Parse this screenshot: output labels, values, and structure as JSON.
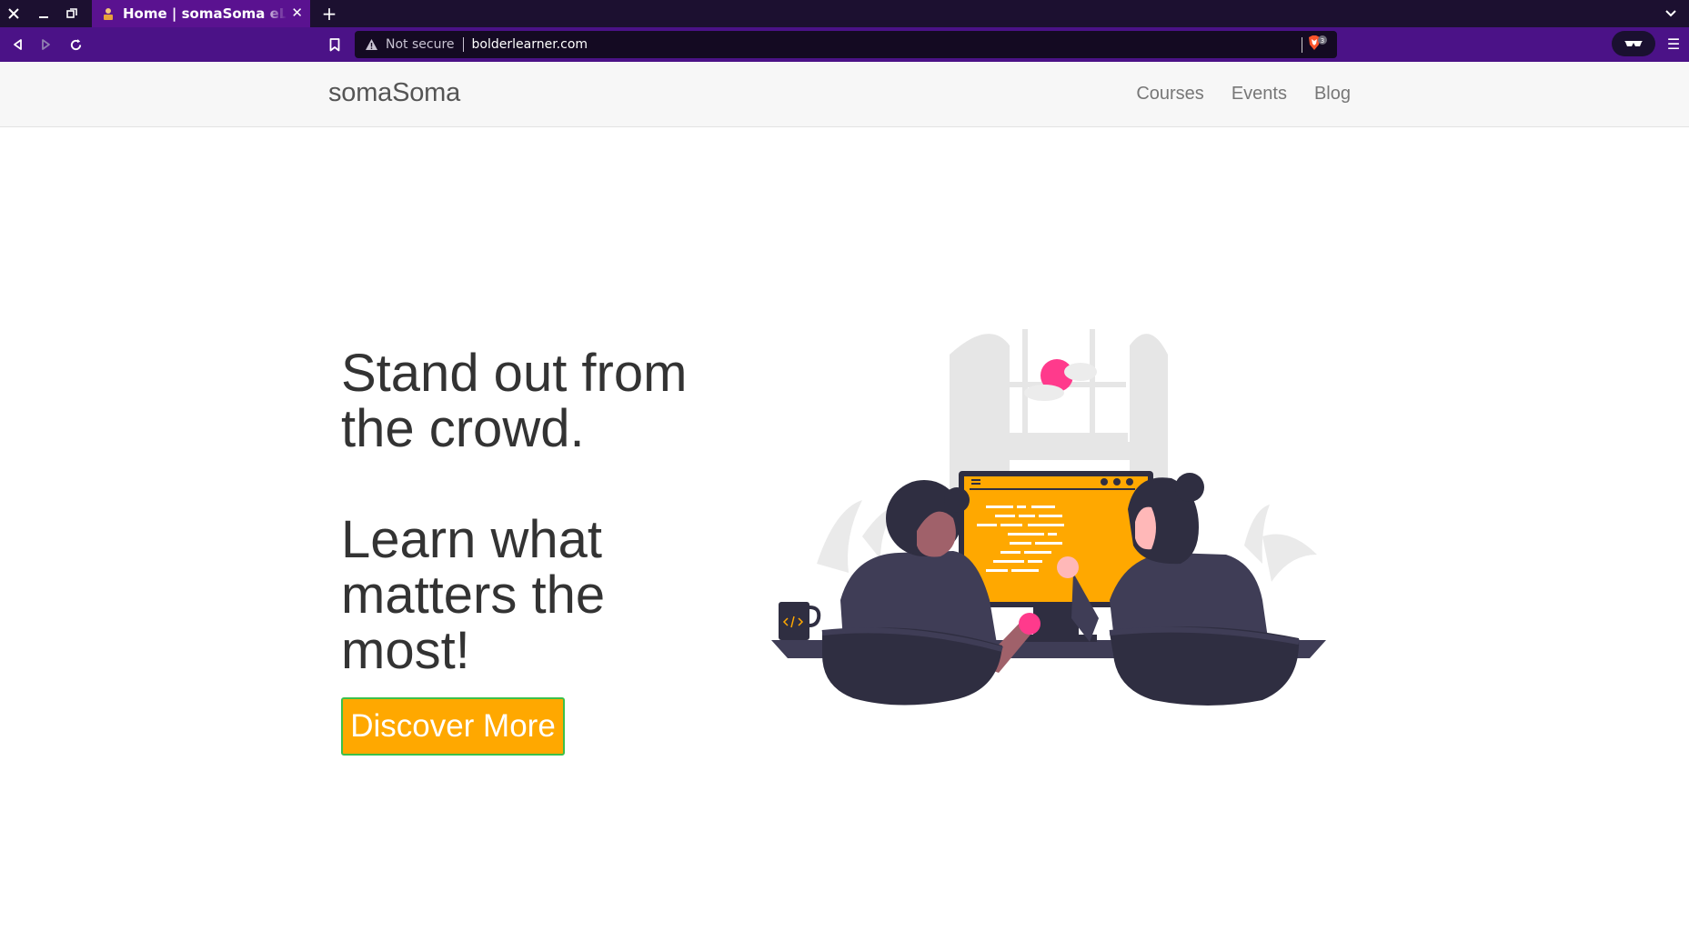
{
  "browser": {
    "tab": {
      "title": "Home | somaSoma eLearni",
      "close_glyph": "✕",
      "favicon": "teacher-favicon-icon"
    },
    "new_tab_glyph": "+",
    "tab_list_glyph": "⌄",
    "window_controls": [
      "close-icon",
      "minimize-icon",
      "restore-icon"
    ],
    "nav": {
      "back": "back-icon",
      "forward": "forward-icon",
      "reload": "reload-icon",
      "bookmark": "bookmark-icon"
    },
    "url": {
      "security_label": "Not secure",
      "address": "bolderlearner.com"
    },
    "shield_badge": "3",
    "menu_glyph": "☰",
    "colors": {
      "tabbar": "#1c1030",
      "active_tab": "#5a1290",
      "toolbar": "#4b1287",
      "urlbar": "#140a22"
    }
  },
  "site": {
    "brand": "somaSoma",
    "nav": {
      "courses": "Courses",
      "events": "Events",
      "blog": "Blog"
    },
    "hero": {
      "line1": "Stand out from",
      "line2": "the crowd.",
      "line3": "Learn what",
      "line4": "matters the",
      "line5": "most!"
    },
    "cta_label": "Discover More",
    "colors": {
      "accent": "#ffa800",
      "cta_border": "#3cc04a",
      "illustration_dark": "#2f2e41",
      "illustration_pink": "#ff3a8c"
    }
  }
}
